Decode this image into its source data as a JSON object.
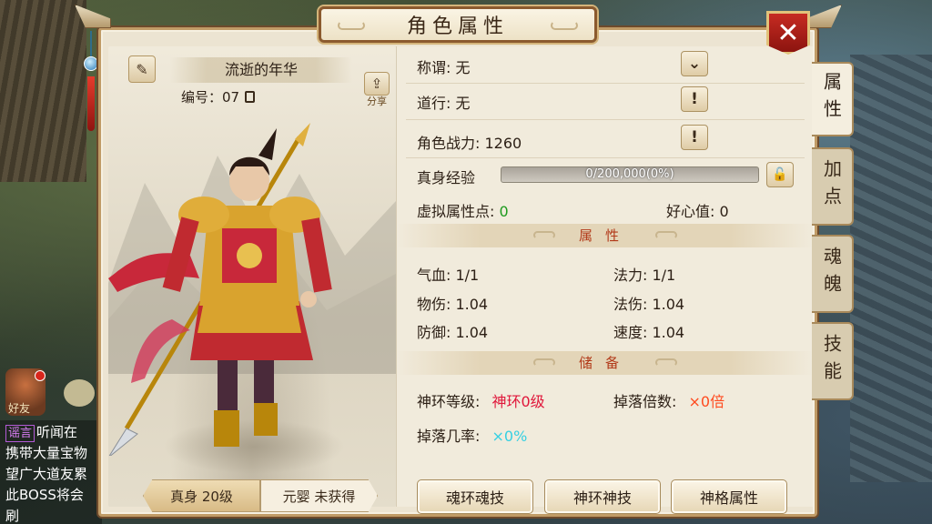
{
  "window": {
    "title": "角色属性",
    "close_glyph": "✕"
  },
  "character": {
    "name": "流逝的年华",
    "id_label": "编号：07",
    "share_label": "分享",
    "true_body_tab": "真身 20级",
    "yuanying_tab": "元婴 未获得"
  },
  "info": {
    "title_label": "称谓: 无",
    "daoxing_label": "道行: 无",
    "power_label": "角色战力: 1260",
    "exp_label": "真身经验",
    "exp_text": "0/200,000(0%)",
    "exp_progress": 0,
    "virtual_points_label": "虚拟属性点:",
    "virtual_points_value": "0",
    "goodwill_label": "好心值: 0"
  },
  "attributes": {
    "header": "属性",
    "hp": "气血: 1/1",
    "mana": "法力: 1/1",
    "phys_dmg": "物伤: 1.04",
    "mag_dmg": "法伤: 1.04",
    "defense": "防御: 1.04",
    "speed": "速度: 1.04"
  },
  "reserve": {
    "header": "储备",
    "ring_label": "神环等级:",
    "ring_value": "神环0级",
    "drop_mult_label": "掉落倍数:",
    "drop_mult_value": "×0倍",
    "drop_rate_label": "掉落几率:",
    "drop_rate_value": "×0%"
  },
  "buttons": {
    "soul_ring": "魂环魂技",
    "god_ring": "神环神技",
    "god_attr": "神格属性"
  },
  "side_tabs": [
    "属性",
    "加点",
    "魂魄",
    "技能"
  ],
  "chat": {
    "friend_label": "好友",
    "tag": "谣言",
    "line1": "听闻在",
    "line2": "携带大量宝物",
    "line3": "望广大道友累",
    "line4": "此BOSS将会刷"
  },
  "icons": {
    "edit": "pencil-icon",
    "share": "share-icon",
    "copy": "copy-icon",
    "dropdown": "chevron-down-icon",
    "info": "exclamation-icon",
    "lock": "unlock-icon",
    "close": "close-icon"
  },
  "colors": {
    "accent_red": "#b23a1a",
    "value_green": "#1e9a1e",
    "value_red": "#e0163a",
    "value_orange": "#ff4a1e",
    "value_cyan": "#35d0e2"
  }
}
